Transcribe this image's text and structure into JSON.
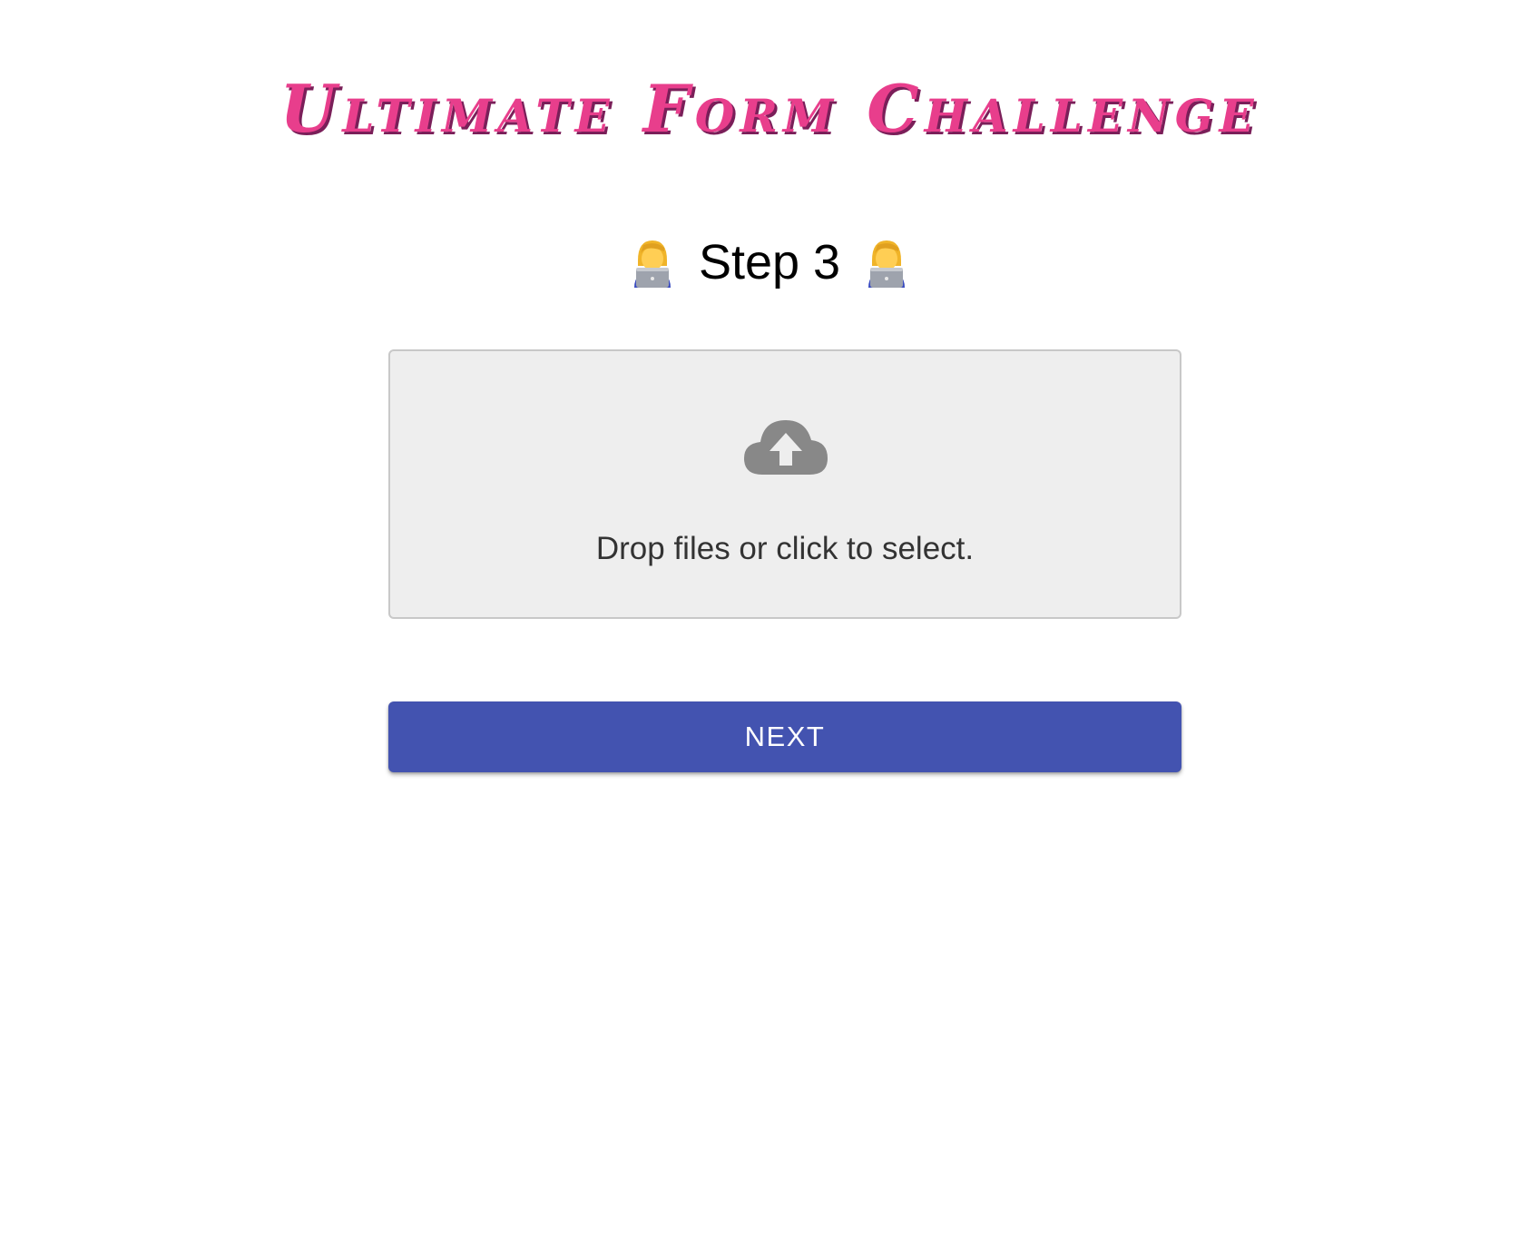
{
  "header": {
    "title": "Ultimate Form Challenge",
    "title_color": "#e83e8c"
  },
  "step": {
    "label": "Step 3",
    "left_icon": "woman-technologist-icon",
    "right_icon": "woman-technologist-icon"
  },
  "dropzone": {
    "icon": "cloud-upload-icon",
    "text": "Drop files or click to select.",
    "background": "#eeeeee"
  },
  "actions": {
    "next_label": "Next",
    "next_color": "#4353b0"
  }
}
